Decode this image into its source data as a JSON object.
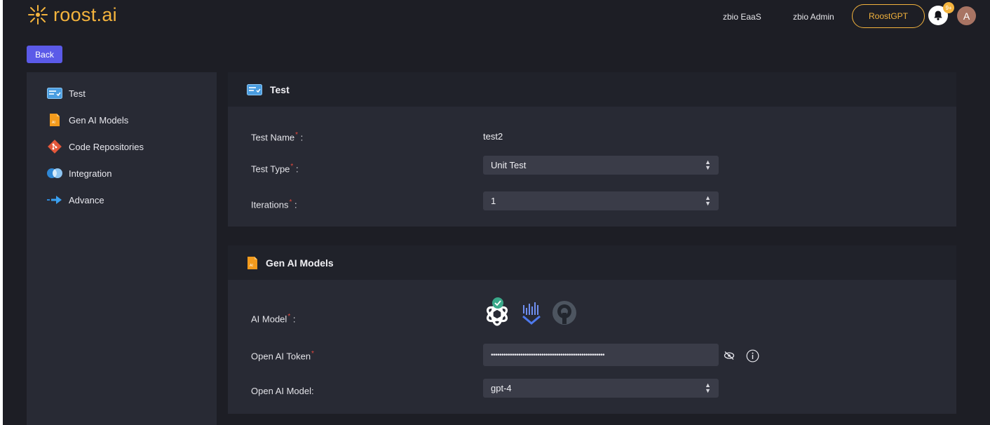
{
  "header": {
    "logo_text": "roost.ai",
    "links": [
      "zbio EaaS",
      "zbio Admin"
    ],
    "cta_label": "RoostGPT",
    "notification_badge": "9+",
    "avatar_initial": "A"
  },
  "back_label": "Back",
  "sidebar": {
    "items": [
      {
        "label": "Test",
        "icon": "test-list-icon"
      },
      {
        "label": "Gen AI Models",
        "icon": "ai-file-icon"
      },
      {
        "label": "Code Repositories",
        "icon": "git-icon"
      },
      {
        "label": "Integration",
        "icon": "integration-icon"
      },
      {
        "label": "Advance",
        "icon": "arrow-right-icon"
      }
    ]
  },
  "test_section": {
    "title": "Test",
    "test_name_label": "Test Name",
    "test_name_value": "test2",
    "test_type_label": "Test Type",
    "test_type_value": "Unit Test",
    "iterations_label": "Iterations",
    "iterations_value": "1",
    "colon": ":"
  },
  "gen_ai_section": {
    "title": "Gen AI Models",
    "ai_model_label": "AI Model",
    "models": [
      {
        "icon": "openai-icon",
        "selected": true
      },
      {
        "icon": "vertex-ai-icon",
        "selected": false
      },
      {
        "icon": "open-source-icon",
        "selected": false
      }
    ],
    "token_label": "Open AI Token",
    "token_value": "••••••••••••••••••••••••••••••••••••••••••••••••••••••",
    "model_label": "Open AI Model:",
    "model_value": "gpt-4"
  },
  "colors": {
    "accent": "#f3b33d",
    "back_button": "#5b5ae8",
    "required": "#e5483d",
    "background": "#1d1e25",
    "panel": "#282a34"
  }
}
